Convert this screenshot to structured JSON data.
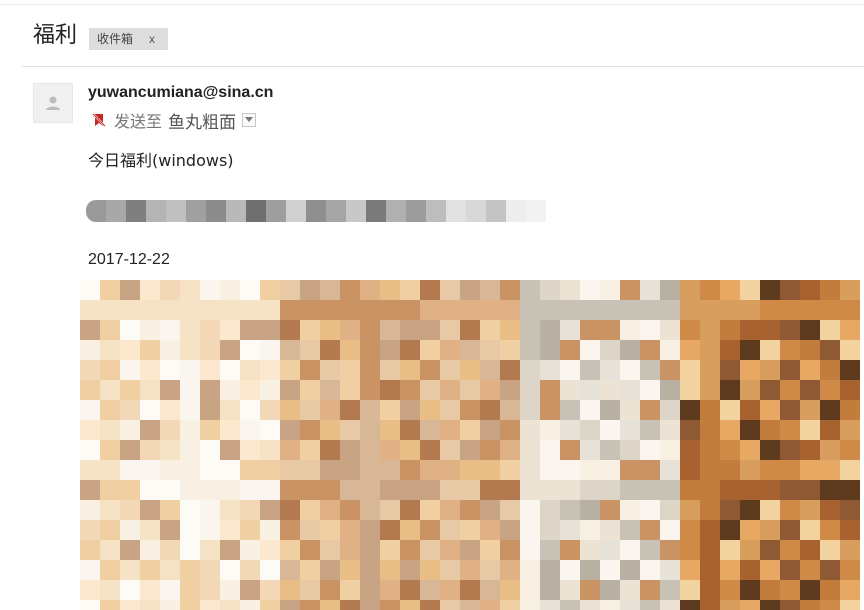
{
  "email": {
    "subject": "福利",
    "label": {
      "text": "收件箱",
      "close": "x"
    },
    "sender": "yuwancumiana@sina.cn",
    "sent_to_prefix": "发送至",
    "recipient": "鱼丸粗面",
    "body_line": "今日福利(windows)",
    "date": "2017-12-22"
  },
  "icons": {
    "avatar": "default-avatar-icon",
    "sent": "no-reply-icon",
    "dropdown": "chevron-down-icon"
  },
  "colors": {
    "label_chip_bg": "#dddddd",
    "sent_icon": "#c62828",
    "divider": "#e0e0e0"
  },
  "redacted_link_blocks": [
    "#9a9a9a",
    "#a8a8a8",
    "#7f7f7f",
    "#b4b4b4",
    "#c0c0c0",
    "#a0a0a0",
    "#8c8c8c",
    "#b9b9b9",
    "#6f6f6f",
    "#9e9e9e",
    "#d0d0d0",
    "#8f8f8f",
    "#a5a5a5",
    "#c8c8c8",
    "#7a7a7a",
    "#b0b0b0",
    "#9c9c9c",
    "#bdbdbd",
    "#e1e1e1",
    "#d8d8d8",
    "#c4c4c4",
    "#ededed",
    "#f2f2f2"
  ],
  "mosaic_palette": [
    "#f6e3c6",
    "#f0cfa3",
    "#e9bd86",
    "#f8f0e3",
    "#fdfbf6",
    "#dfb184",
    "#c99364",
    "#b27a4e",
    "#8e5a36",
    "#6b3f22",
    "#f3d8b8",
    "#e8c9a6",
    "#d8b796",
    "#c9a484",
    "#fbe8cf",
    "#f2d29e",
    "#e6a862",
    "#cf8a47",
    "#a86230",
    "#ede3d4",
    "#ddd5c8",
    "#c8c1b5",
    "#b8b0a2",
    "#e7e2d7",
    "#faf6ef",
    "#d79e5e",
    "#c27c3b",
    "#8f5a33",
    "#5e3a1f",
    "#3f2a1a"
  ]
}
